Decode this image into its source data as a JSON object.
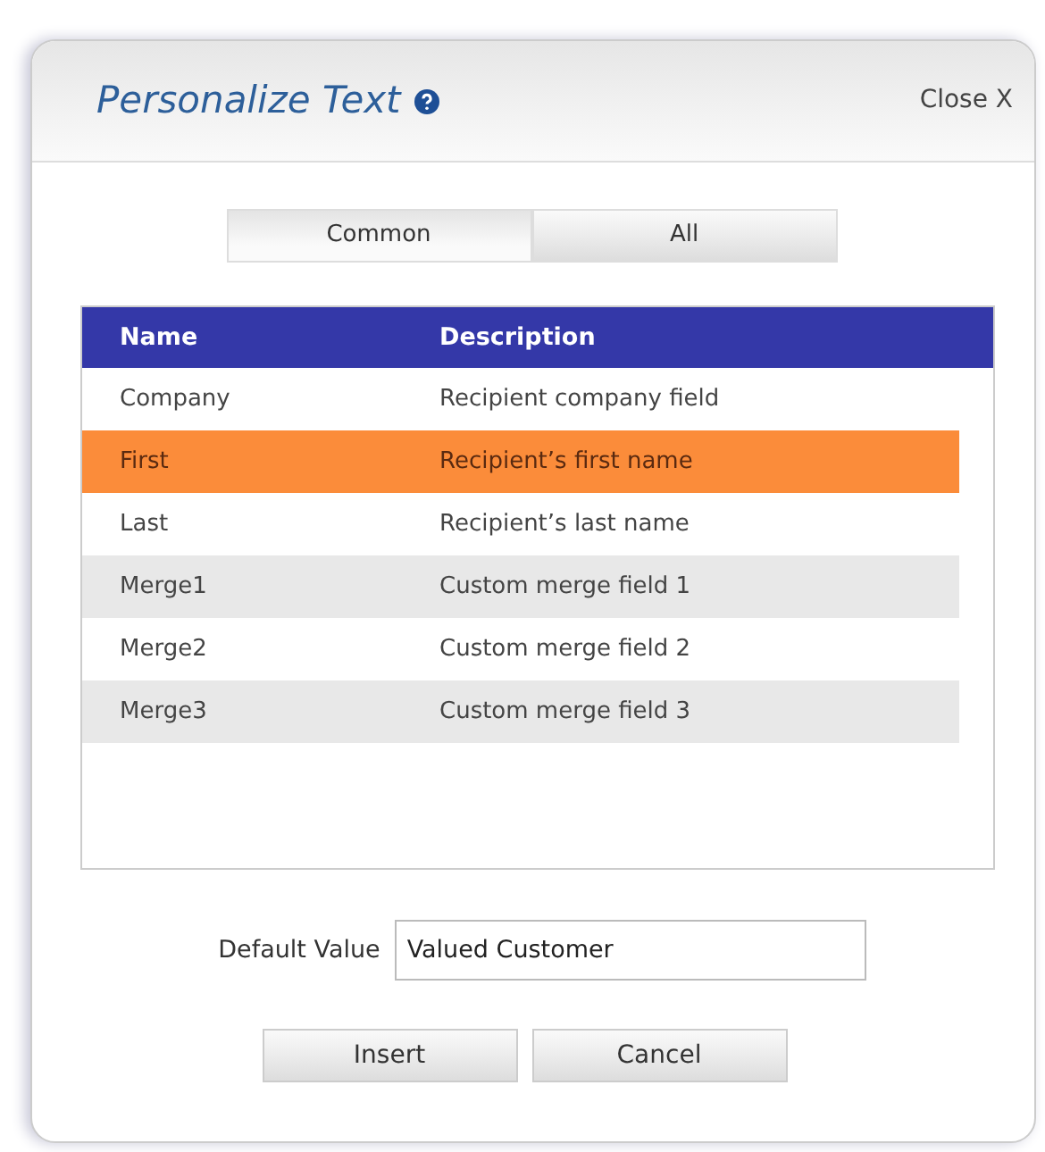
{
  "dialog": {
    "title": "Personalize Text",
    "close": "Close X"
  },
  "tabs": [
    {
      "label": "Common",
      "selected": true
    },
    {
      "label": "All",
      "selected": false
    }
  ],
  "table": {
    "columns": [
      "Name",
      "Description"
    ],
    "rows": [
      {
        "cells": [
          "Company",
          "Recipient company field"
        ],
        "selected": false
      },
      {
        "cells": [
          "First",
          "Recipient’s first name"
        ],
        "selected": true
      },
      {
        "cells": [
          "Last",
          "Recipient’s last name"
        ],
        "selected": false
      },
      {
        "cells": [
          "Merge1",
          "Custom merge field 1"
        ],
        "selected": false
      },
      {
        "cells": [
          "Merge2",
          "Custom merge field 2"
        ],
        "selected": false
      },
      {
        "cells": [
          "Merge3",
          "Custom merge field 3"
        ],
        "selected": false
      }
    ]
  },
  "default_value": {
    "label": "Default Value",
    "value": "Valued Customer"
  },
  "buttons": [
    "Insert",
    "Cancel"
  ]
}
